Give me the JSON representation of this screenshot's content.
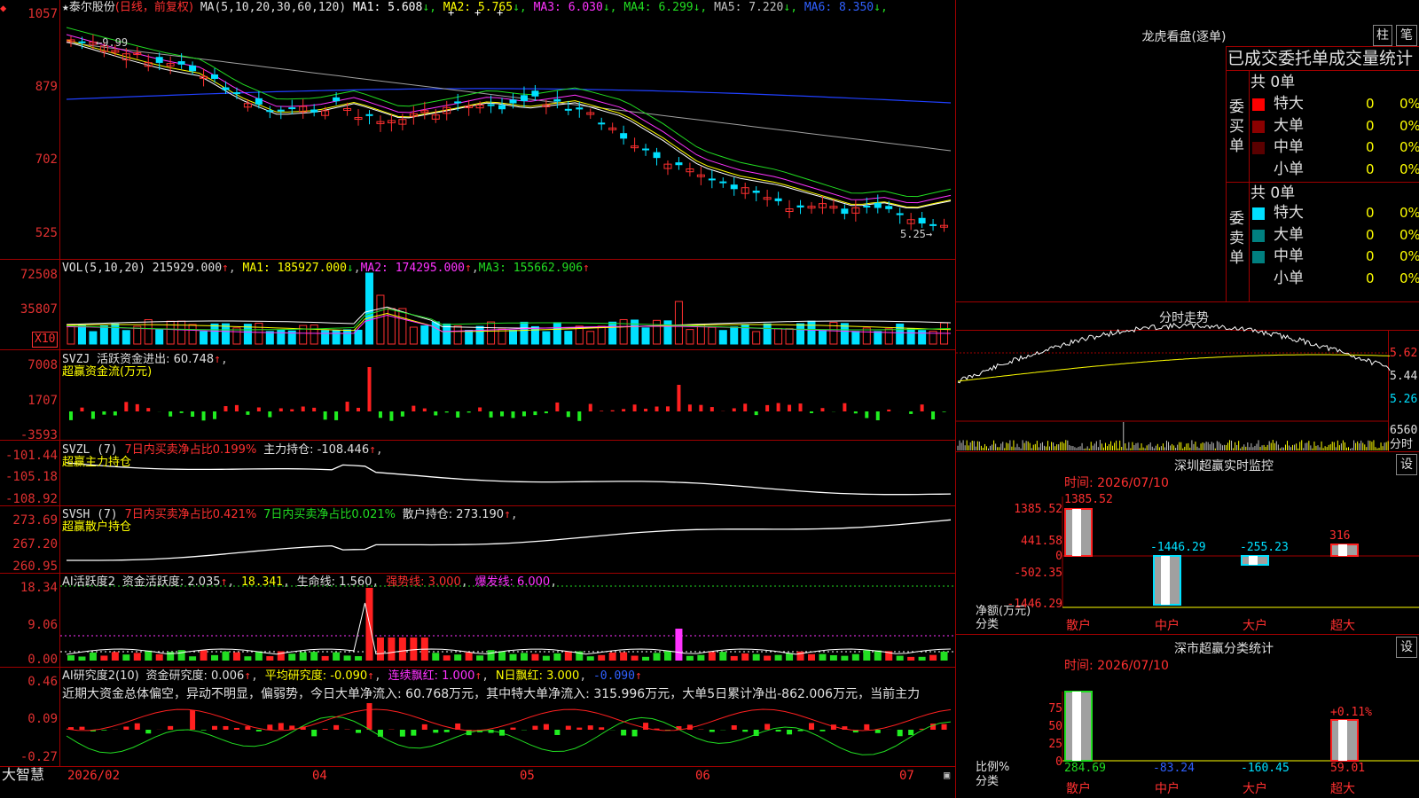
{
  "header": {
    "star": "★",
    "name": "泰尔股份",
    "mode": "(日线，前复权)",
    "ma_group": "MA(5,10,20,30,60,120)",
    "ma": [
      {
        "k": "MA1:",
        "v": "5.608",
        "c": "#ffffff"
      },
      {
        "k": "MA2:",
        "v": "5.765",
        "c": "#ffff00"
      },
      {
        "k": "MA3:",
        "v": "6.030",
        "c": "#ff33ff"
      },
      {
        "k": "MA4:",
        "v": "6.299",
        "c": "#22dd22"
      },
      {
        "k": "MA5:",
        "v": "7.220",
        "c": "#c0c0c0"
      },
      {
        "k": "MA6:",
        "v": "8.350",
        "c": "#3060ff"
      }
    ],
    "arrow": "↓"
  },
  "price_axis": [
    "1057",
    "879",
    "702",
    "525"
  ],
  "price_marks": {
    "high": "9.99",
    "low": "5.25"
  },
  "vol": {
    "title": "VOL(5,10,20)",
    "v": "215929.000",
    "ma1": "MA1: 185927.000",
    "ma2": "MA2: 174295.000",
    "ma3": "MA3: 155662.906",
    "axis": [
      "72508",
      "35807"
    ],
    "unit": "X10"
  },
  "svzj": {
    "title": "SVZJ",
    "label": "活跃资金进出: 60.748",
    "sub": "超赢资金流(万元)",
    "axis": [
      "7008",
      "1707",
      "-3593"
    ]
  },
  "svzl": {
    "title": "SVZL (7)",
    "pct": "7日内买卖净占比0.199%",
    "hold": "主力持仓: -108.446",
    "sub": "超赢主力持仓",
    "axis": [
      "-101.44",
      "-105.18",
      "-108.92"
    ]
  },
  "svsh": {
    "title": "SVSH (7)",
    "pct1": "7日内买卖净占比0.421%",
    "pct2": "7日内买卖净占比0.021%",
    "hold": "散户持仓: 273.190",
    "sub": "超赢散户持仓",
    "axis": [
      "273.69",
      "267.20",
      "260.95"
    ]
  },
  "ai1": {
    "title": "AI活跃度2",
    "a": "资金活跃度: 2.035",
    "b": "18.341",
    "c": "生命线: 1.560",
    "d": "强势线: 3.000",
    "e": "爆发线: 6.000",
    "axis": [
      "18.34",
      "9.06",
      "0.00"
    ]
  },
  "ai2": {
    "title": "AI研究度2(10)",
    "a": "资金研究度: 0.006",
    "b": "平均研究度: -0.090",
    "c": "连续飘红: 1.000",
    "d": "N日飘红: 3.000",
    "e": "-0.090",
    "text": "近期大资金总体偏空，异动不明显，偏弱势，今日大单净流入: 60.768万元，其中特大单净流入: 315.996万元，大单5日累计净出-862.006万元，当前主力",
    "axis": [
      "0.46",
      "0.09",
      "-0.27"
    ]
  },
  "bottom": {
    "brand": "大智慧",
    "dates": [
      "2026/02",
      "04",
      "05",
      "06",
      "07"
    ]
  },
  "right": {
    "lhb_title": "龙虎看盘(逐单)",
    "btn_zhu": "柱",
    "btn_bi": "笔",
    "stats_title": "已成交委托单成交量统计",
    "buy_side": "委买单",
    "sell_side": "委卖单",
    "buy_total": "共 0单",
    "sell_total": "共 0单",
    "rows": [
      {
        "name": "特大",
        "n": "0",
        "p": "0%"
      },
      {
        "name": "大单",
        "n": "0",
        "p": "0%"
      },
      {
        "name": "中单",
        "n": "0",
        "p": "0%"
      },
      {
        "name": "小单",
        "n": "0",
        "p": "0%"
      }
    ],
    "fs_title": "分时走势",
    "fs_axis": [
      "5.62",
      "5.44",
      "5.26",
      "6560"
    ],
    "fs_unit": "分时",
    "mon_title": "深圳超赢实时监控",
    "settings": "设",
    "mon_time": "时间: 2026/07/10",
    "mon_axis": [
      "1385.52",
      "441.58",
      "0",
      "-502.35",
      "-1446.29"
    ],
    "mon_vals": [
      "1385.52",
      "-1446.29",
      "-255.23",
      "316"
    ],
    "mon_ylab": "净额(万元)",
    "mon_xlab": "分类",
    "cats": [
      "散户",
      "中户",
      "大户",
      "超大"
    ],
    "cls_title": "深市超赢分类统计",
    "cls_time": "时间: 2026/07/10",
    "cls_axis": [
      "75",
      "50",
      "25",
      "0"
    ],
    "cls_vals": [
      "284.69",
      "-83.24",
      "-160.45",
      "59.01"
    ],
    "cls_pct": "+0.11%",
    "cls_ylab": "比例%",
    "cls_xlab": "分类"
  }
}
